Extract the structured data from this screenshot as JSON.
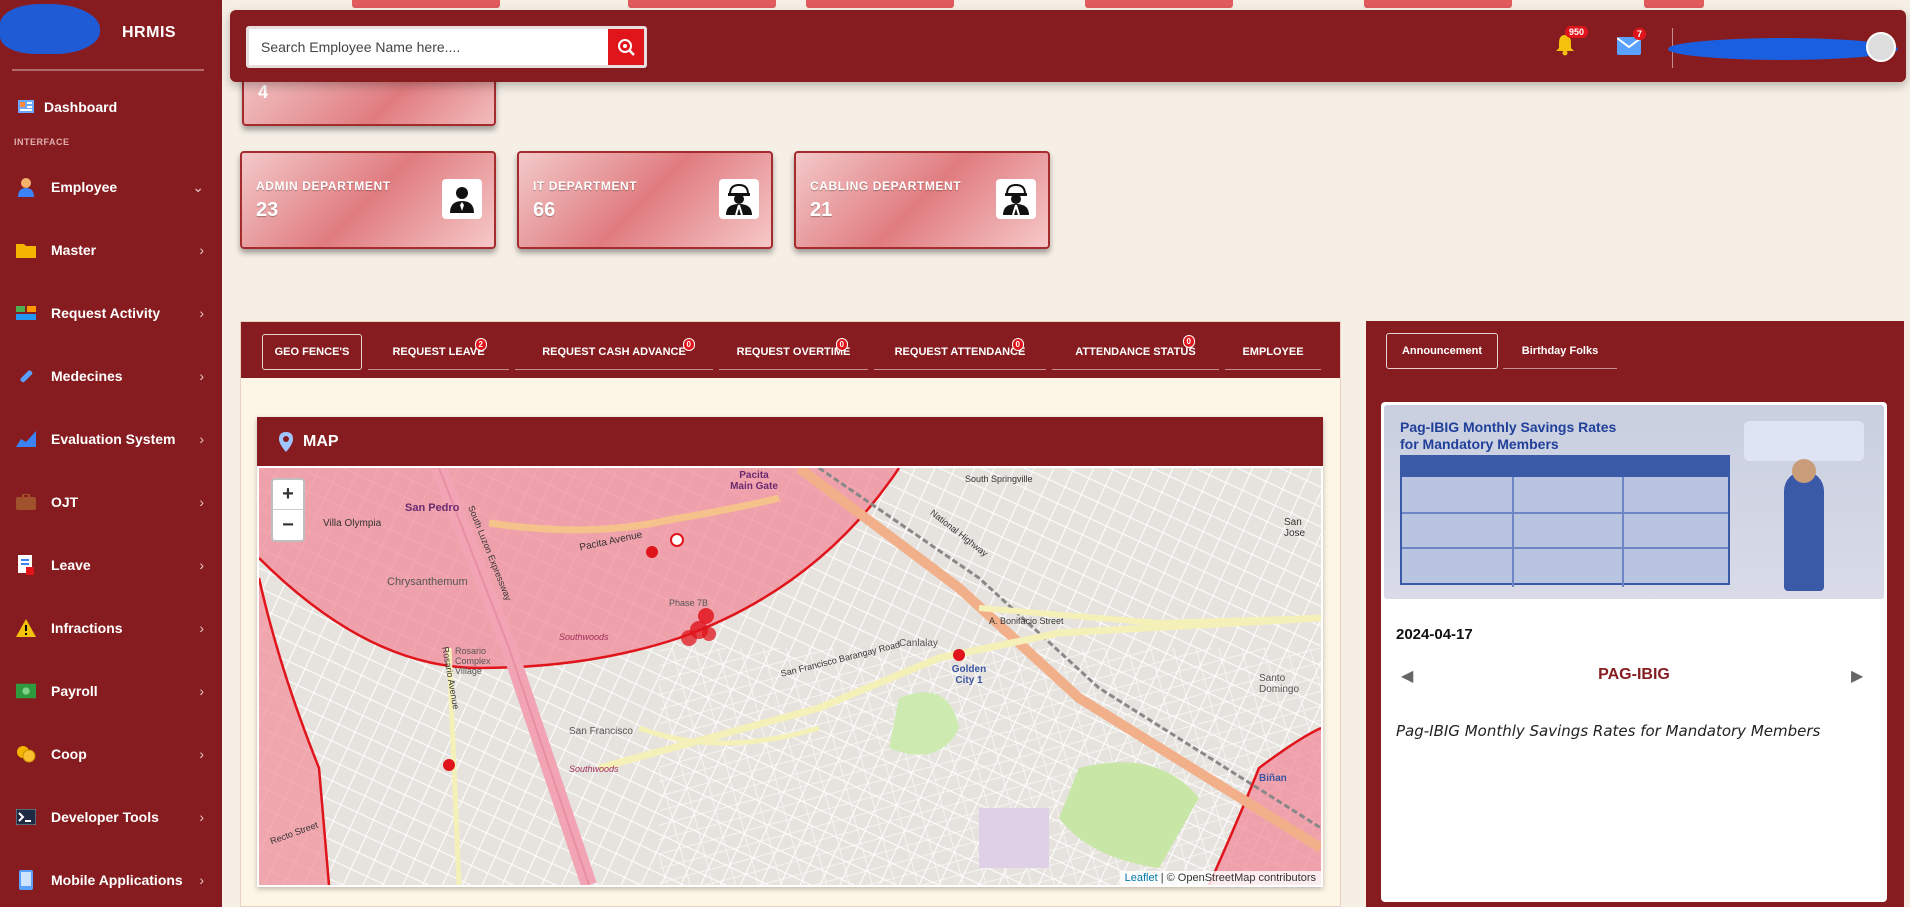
{
  "app": {
    "brand": "HRMIS"
  },
  "sidebar": {
    "dashboard": "Dashboard",
    "section_heading": "INTERFACE",
    "items": [
      {
        "label": "Employee",
        "icon": "person-icon"
      },
      {
        "label": "Master",
        "icon": "folder-icon"
      },
      {
        "label": "Request Activity",
        "icon": "activity-icon"
      },
      {
        "label": "Medecines",
        "icon": "pill-icon"
      },
      {
        "label": "Evaluation System",
        "icon": "chart-icon"
      },
      {
        "label": "OJT",
        "icon": "briefcase-icon"
      },
      {
        "label": "Leave",
        "icon": "document-icon"
      },
      {
        "label": "Infractions",
        "icon": "warning-icon"
      },
      {
        "label": "Payroll",
        "icon": "money-icon"
      },
      {
        "label": "Coop",
        "icon": "coins-icon"
      },
      {
        "label": "Developer Tools",
        "icon": "terminal-icon"
      },
      {
        "label": "Mobile Applications",
        "icon": "mobile-icon"
      }
    ]
  },
  "topbar": {
    "search_placeholder": "Search Employee Name here....",
    "notifications_count": "950",
    "messages_count": "7"
  },
  "partial_card": {
    "value": "4"
  },
  "department_cards": [
    {
      "title": "ADMIN DEPARTMENT",
      "value": "23",
      "icon": "user-tie-icon"
    },
    {
      "title": "IT DEPARTMENT",
      "value": "66",
      "icon": "hard-hat-worker-icon"
    },
    {
      "title": "CABLING DEPARTMENT",
      "value": "21",
      "icon": "hard-hat-worker-icon"
    }
  ],
  "tabs": [
    {
      "label": "GEO FENCE'S",
      "badge": ""
    },
    {
      "label": "REQUEST LEAVE",
      "badge": "2"
    },
    {
      "label": "REQUEST CASH ADVANCE",
      "badge": "0"
    },
    {
      "label": "REQUEST OVERTIME",
      "badge": "0"
    },
    {
      "label": "REQUEST ATTENDANCE",
      "badge": "0"
    },
    {
      "label": "ATTENDANCE STATUS",
      "badge": "0"
    },
    {
      "label": "EMPLOYEE",
      "badge": ""
    }
  ],
  "map": {
    "title": "MAP",
    "zoom_in": "+",
    "zoom_out": "−",
    "attribution_leaflet": "Leaflet",
    "attribution_rest": "| © OpenStreetMap contributors",
    "labels": [
      "San Pedro",
      "Pacita Main Gate",
      "South Springville",
      "San Jose",
      "Villa Olympia",
      "Chrysanthemum",
      "Pacita Avenue",
      "National Highway",
      "Phase 7B",
      "Rosario Complex Village",
      "Southwoods",
      "A. Bonifacio Street",
      "Canlalay",
      "Golden City 1",
      "San Francisco Barangay Road",
      "San Francisco",
      "Santo Domingo",
      "Biñan",
      "Southwoods",
      "Rosario Avenue",
      "South Luzon Expressway",
      "Recto Street"
    ]
  },
  "right_tabs": [
    {
      "label": "Announcement"
    },
    {
      "label": "Birthday Folks"
    }
  ],
  "announcement": {
    "image_heading": "Pag-IBIG Monthly Savings Rates for Mandatory Members",
    "date": "2024-04-17",
    "title": "PAG-IBIG",
    "description": "Pag-IBIG Monthly Savings Rates for Mandatory Members"
  },
  "colors": {
    "primary": "#861c1f",
    "accent": "#e0141b",
    "card": "#e07c80",
    "map_zone": "#f28b99"
  }
}
